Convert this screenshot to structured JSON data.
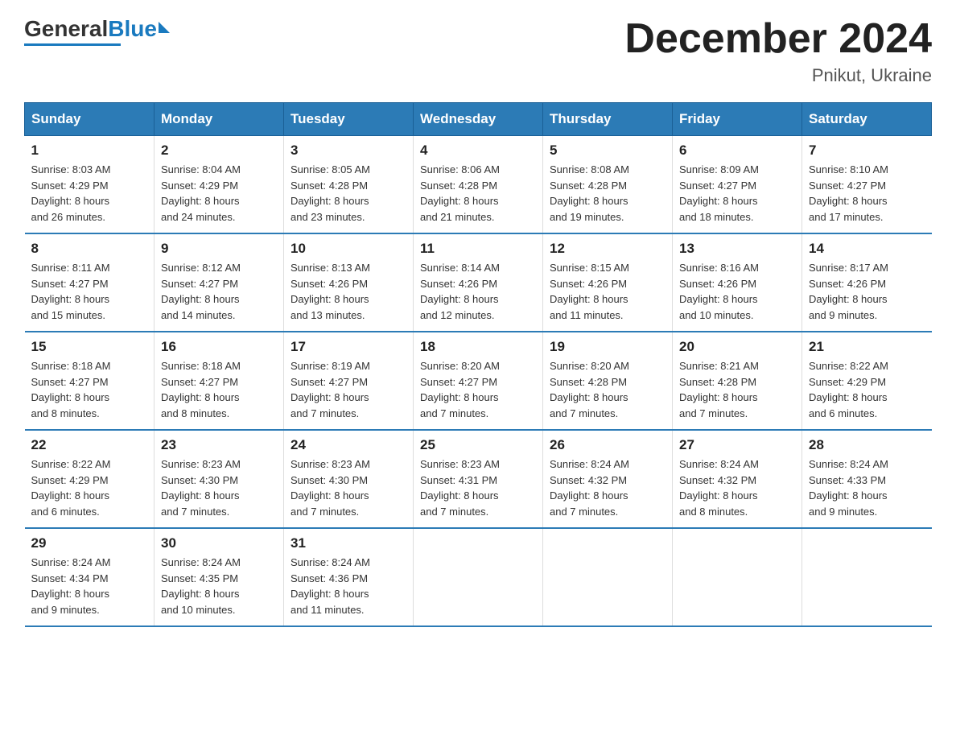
{
  "header": {
    "logo_general": "General",
    "logo_blue": "Blue",
    "month_title": "December 2024",
    "location": "Pnikut, Ukraine"
  },
  "days_of_week": [
    "Sunday",
    "Monday",
    "Tuesday",
    "Wednesday",
    "Thursday",
    "Friday",
    "Saturday"
  ],
  "weeks": [
    [
      {
        "day": "1",
        "sunrise": "8:03 AM",
        "sunset": "4:29 PM",
        "daylight": "8 hours and 26 minutes."
      },
      {
        "day": "2",
        "sunrise": "8:04 AM",
        "sunset": "4:29 PM",
        "daylight": "8 hours and 24 minutes."
      },
      {
        "day": "3",
        "sunrise": "8:05 AM",
        "sunset": "4:28 PM",
        "daylight": "8 hours and 23 minutes."
      },
      {
        "day": "4",
        "sunrise": "8:06 AM",
        "sunset": "4:28 PM",
        "daylight": "8 hours and 21 minutes."
      },
      {
        "day": "5",
        "sunrise": "8:08 AM",
        "sunset": "4:28 PM",
        "daylight": "8 hours and 19 minutes."
      },
      {
        "day": "6",
        "sunrise": "8:09 AM",
        "sunset": "4:27 PM",
        "daylight": "8 hours and 18 minutes."
      },
      {
        "day": "7",
        "sunrise": "8:10 AM",
        "sunset": "4:27 PM",
        "daylight": "8 hours and 17 minutes."
      }
    ],
    [
      {
        "day": "8",
        "sunrise": "8:11 AM",
        "sunset": "4:27 PM",
        "daylight": "8 hours and 15 minutes."
      },
      {
        "day": "9",
        "sunrise": "8:12 AM",
        "sunset": "4:27 PM",
        "daylight": "8 hours and 14 minutes."
      },
      {
        "day": "10",
        "sunrise": "8:13 AM",
        "sunset": "4:26 PM",
        "daylight": "8 hours and 13 minutes."
      },
      {
        "day": "11",
        "sunrise": "8:14 AM",
        "sunset": "4:26 PM",
        "daylight": "8 hours and 12 minutes."
      },
      {
        "day": "12",
        "sunrise": "8:15 AM",
        "sunset": "4:26 PM",
        "daylight": "8 hours and 11 minutes."
      },
      {
        "day": "13",
        "sunrise": "8:16 AM",
        "sunset": "4:26 PM",
        "daylight": "8 hours and 10 minutes."
      },
      {
        "day": "14",
        "sunrise": "8:17 AM",
        "sunset": "4:26 PM",
        "daylight": "8 hours and 9 minutes."
      }
    ],
    [
      {
        "day": "15",
        "sunrise": "8:18 AM",
        "sunset": "4:27 PM",
        "daylight": "8 hours and 8 minutes."
      },
      {
        "day": "16",
        "sunrise": "8:18 AM",
        "sunset": "4:27 PM",
        "daylight": "8 hours and 8 minutes."
      },
      {
        "day": "17",
        "sunrise": "8:19 AM",
        "sunset": "4:27 PM",
        "daylight": "8 hours and 7 minutes."
      },
      {
        "day": "18",
        "sunrise": "8:20 AM",
        "sunset": "4:27 PM",
        "daylight": "8 hours and 7 minutes."
      },
      {
        "day": "19",
        "sunrise": "8:20 AM",
        "sunset": "4:28 PM",
        "daylight": "8 hours and 7 minutes."
      },
      {
        "day": "20",
        "sunrise": "8:21 AM",
        "sunset": "4:28 PM",
        "daylight": "8 hours and 7 minutes."
      },
      {
        "day": "21",
        "sunrise": "8:22 AM",
        "sunset": "4:29 PM",
        "daylight": "8 hours and 6 minutes."
      }
    ],
    [
      {
        "day": "22",
        "sunrise": "8:22 AM",
        "sunset": "4:29 PM",
        "daylight": "8 hours and 6 minutes."
      },
      {
        "day": "23",
        "sunrise": "8:23 AM",
        "sunset": "4:30 PM",
        "daylight": "8 hours and 7 minutes."
      },
      {
        "day": "24",
        "sunrise": "8:23 AM",
        "sunset": "4:30 PM",
        "daylight": "8 hours and 7 minutes."
      },
      {
        "day": "25",
        "sunrise": "8:23 AM",
        "sunset": "4:31 PM",
        "daylight": "8 hours and 7 minutes."
      },
      {
        "day": "26",
        "sunrise": "8:24 AM",
        "sunset": "4:32 PM",
        "daylight": "8 hours and 7 minutes."
      },
      {
        "day": "27",
        "sunrise": "8:24 AM",
        "sunset": "4:32 PM",
        "daylight": "8 hours and 8 minutes."
      },
      {
        "day": "28",
        "sunrise": "8:24 AM",
        "sunset": "4:33 PM",
        "daylight": "8 hours and 9 minutes."
      }
    ],
    [
      {
        "day": "29",
        "sunrise": "8:24 AM",
        "sunset": "4:34 PM",
        "daylight": "8 hours and 9 minutes."
      },
      {
        "day": "30",
        "sunrise": "8:24 AM",
        "sunset": "4:35 PM",
        "daylight": "8 hours and 10 minutes."
      },
      {
        "day": "31",
        "sunrise": "8:24 AM",
        "sunset": "4:36 PM",
        "daylight": "8 hours and 11 minutes."
      },
      null,
      null,
      null,
      null
    ]
  ],
  "labels": {
    "sunrise": "Sunrise: ",
    "sunset": "Sunset: ",
    "daylight": "Daylight: "
  }
}
